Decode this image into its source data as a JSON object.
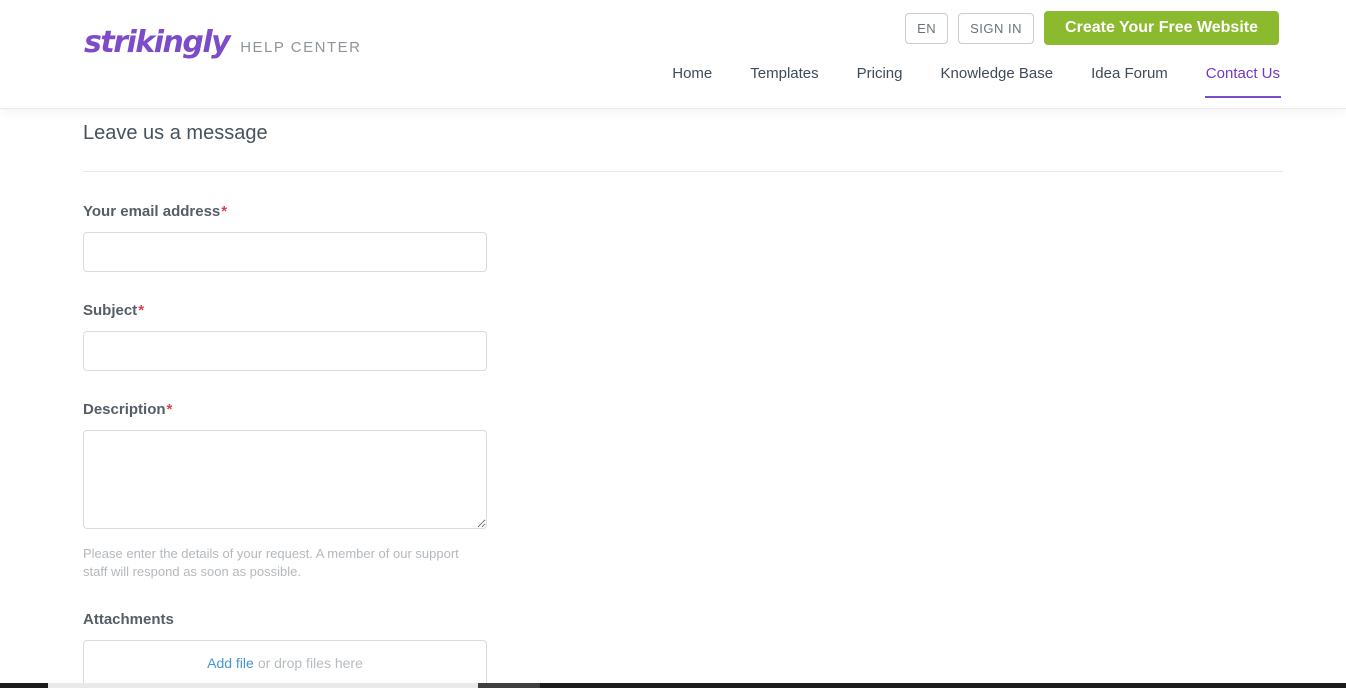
{
  "header": {
    "logo": {
      "brand": "strikingly",
      "suffix": "HELP CENTER"
    },
    "actions": {
      "language_label": "EN",
      "sign_in_label": "SIGN IN",
      "cta_label": "Create Your Free Website"
    },
    "nav": [
      {
        "label": "Home",
        "active": false
      },
      {
        "label": "Templates",
        "active": false
      },
      {
        "label": "Pricing",
        "active": false
      },
      {
        "label": "Knowledge Base",
        "active": false
      },
      {
        "label": "Idea Forum",
        "active": false
      },
      {
        "label": "Contact Us",
        "active": true
      }
    ]
  },
  "page": {
    "title": "Leave us a message"
  },
  "form": {
    "required_marker": "*",
    "fields": [
      {
        "label": "Your email address",
        "required": true,
        "value": "",
        "type": "input"
      },
      {
        "label": "Subject",
        "required": true,
        "value": "",
        "type": "input"
      },
      {
        "label": "Description",
        "required": true,
        "value": "",
        "type": "textarea",
        "help": "Please enter the details of your request. A member of our support staff will respond as soon as possible."
      }
    ],
    "attachments": {
      "label": "Attachments",
      "add_file_label": "Add file",
      "drop_hint": "or drop files here"
    }
  },
  "colors": {
    "brand_purple": "#7d4cc9",
    "nav_active_purple": "#7239bf",
    "cta_green": "#8cba2f",
    "link_blue": "#4596d6",
    "required_red": "#d93f4c"
  }
}
